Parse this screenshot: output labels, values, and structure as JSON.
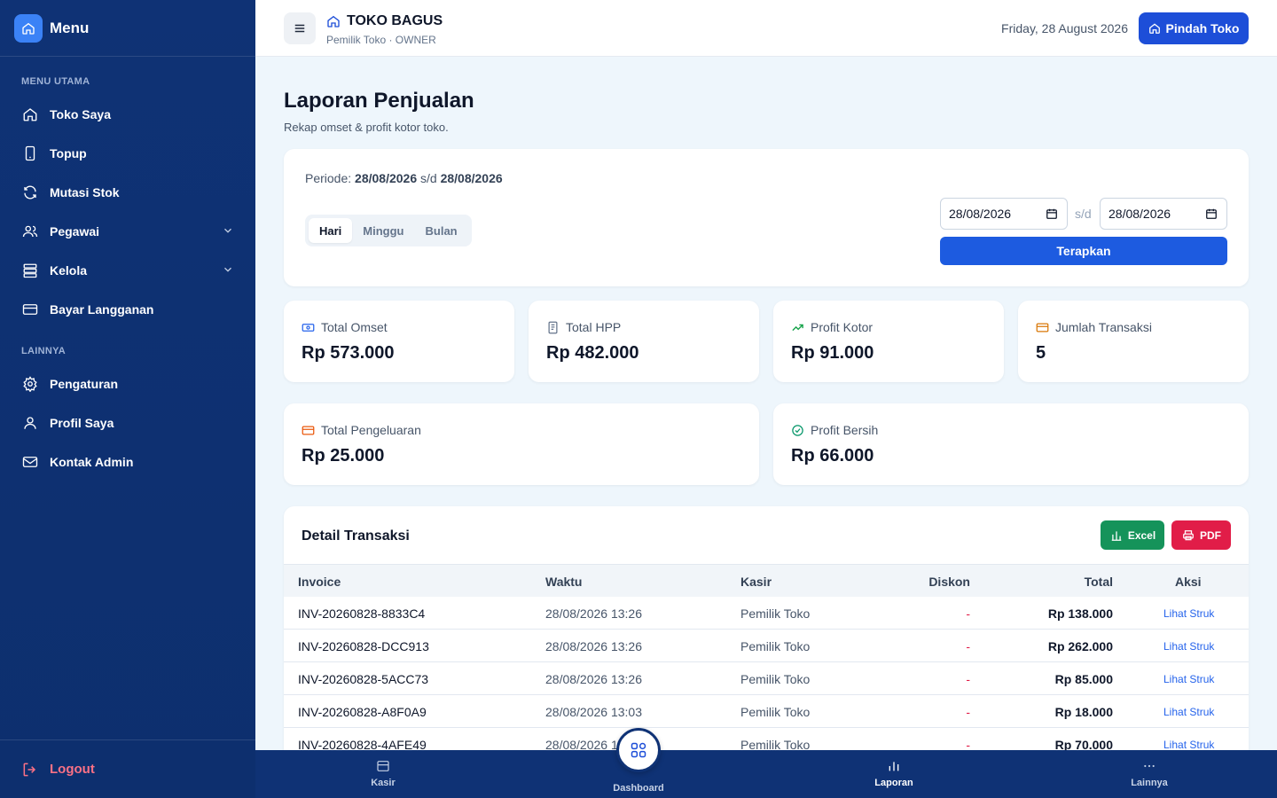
{
  "sidebar": {
    "title": "Menu",
    "section_main": "MENU UTAMA",
    "section_other": "LAINNYA",
    "items": [
      {
        "label": "Toko Saya",
        "icon": "home-icon"
      },
      {
        "label": "Topup",
        "icon": "phone-icon"
      },
      {
        "label": "Mutasi Stok",
        "icon": "refresh-icon"
      },
      {
        "label": "Pegawai",
        "icon": "users-icon"
      },
      {
        "label": "Kelola",
        "icon": "database-icon"
      },
      {
        "label": "Bayar Langganan",
        "icon": "credit-card-icon"
      }
    ],
    "other_items": [
      {
        "label": "Pengaturan",
        "icon": "gear-icon"
      },
      {
        "label": "Profil Saya",
        "icon": "user-icon"
      },
      {
        "label": "Kontak Admin",
        "icon": "mail-icon"
      }
    ],
    "logout": "Logout"
  },
  "header": {
    "store_name": "TOKO BAGUS",
    "store_sub": "Pemilik Toko · OWNER",
    "date": "Friday, 28 August 2026",
    "switch_label": "Pindah Toko"
  },
  "page": {
    "title": "Laporan Penjualan",
    "subtitle": "Rekap omset & profit kotor toko."
  },
  "filter": {
    "periode_label": "Periode:",
    "periode_from": "28/08/2026",
    "periode_sep": "s/d",
    "periode_to": "28/08/2026",
    "tabs": [
      "Hari",
      "Minggu",
      "Bulan"
    ],
    "active_tab": "Hari",
    "date_from": "28/08/2026",
    "date_sep": "s/d",
    "date_to": "28/08/2026",
    "apply_label": "Terapkan"
  },
  "stats": [
    {
      "label": "Total Omset",
      "value": "Rp 573.000",
      "icon": "money-icon",
      "color": "#2563eb"
    },
    {
      "label": "Total HPP",
      "value": "Rp 482.000",
      "icon": "receipt-icon",
      "color": "#64748b"
    },
    {
      "label": "Profit Kotor",
      "value": "Rp 91.000",
      "icon": "trending-up-icon",
      "color": "#16a34a"
    },
    {
      "label": "Jumlah Transaksi",
      "value": "5",
      "icon": "card-icon",
      "color": "#d97706"
    },
    {
      "label": "Total Pengeluaran",
      "value": "Rp 25.000",
      "icon": "wallet-icon",
      "color": "#ea580c"
    },
    {
      "label": "Profit Bersih",
      "value": "Rp 66.000",
      "icon": "check-circle-icon",
      "color": "#059669"
    }
  ],
  "table": {
    "title": "Detail Transaksi",
    "excel_label": "Excel",
    "pdf_label": "PDF",
    "columns": [
      "Invoice",
      "Waktu",
      "Kasir",
      "Diskon",
      "Total",
      "Aksi"
    ],
    "rows": [
      {
        "invoice": "INV-20260828-8833C4",
        "time": "28/08/2026 13:26",
        "kasir": "Pemilik Toko",
        "diskon": "-",
        "total": "Rp 138.000",
        "aksi": "Lihat Struk"
      },
      {
        "invoice": "INV-20260828-DCC913",
        "time": "28/08/2026 13:26",
        "kasir": "Pemilik Toko",
        "diskon": "-",
        "total": "Rp 262.000",
        "aksi": "Lihat Struk"
      },
      {
        "invoice": "INV-20260828-5ACC73",
        "time": "28/08/2026 13:26",
        "kasir": "Pemilik Toko",
        "diskon": "-",
        "total": "Rp 85.000",
        "aksi": "Lihat Struk"
      },
      {
        "invoice": "INV-20260828-A8F0A9",
        "time": "28/08/2026 13:03",
        "kasir": "Pemilik Toko",
        "diskon": "-",
        "total": "Rp 18.000",
        "aksi": "Lihat Struk"
      },
      {
        "invoice": "INV-20260828-4AFE49",
        "time": "28/08/2026 1",
        "kasir": "Pemilik Toko",
        "diskon": "-",
        "total": "Rp 70.000",
        "aksi": "Lihat Struk"
      }
    ]
  },
  "bottom_nav": {
    "items": [
      {
        "label": "Kasir",
        "icon": "cashier-icon"
      },
      {
        "label": "Dashboard",
        "icon": "grid-icon"
      },
      {
        "label": "Laporan",
        "icon": "bar-chart-icon"
      },
      {
        "label": "Lainnya",
        "icon": "more-icon"
      }
    ],
    "active": "Laporan"
  },
  "colors": {
    "sidebar_bg": "#0f3275",
    "primary": "#1d4ed8",
    "excel": "#15935a",
    "pdf": "#e11d48",
    "logout": "#fb7185"
  }
}
